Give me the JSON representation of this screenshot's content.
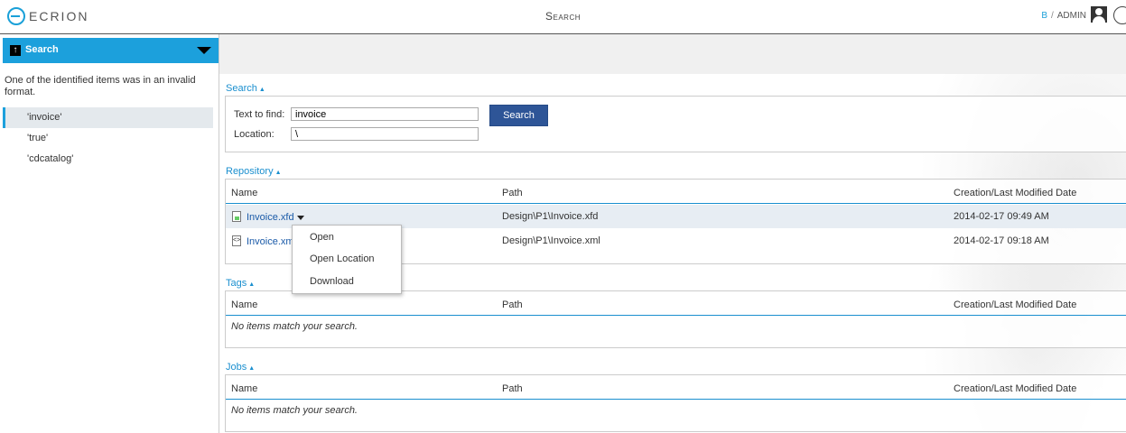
{
  "header": {
    "logo_text": "ECRION",
    "page_title": "Search",
    "user_b": "B",
    "user_sep": "/",
    "user_name": "ADMIN",
    "avatar_icon": "user-avatar-icon",
    "help_icon": "help-icon"
  },
  "sidebar": {
    "title": "Search",
    "icon": "upload-arrow-icon",
    "message": "One of the identified items was in an invalid format.",
    "items": [
      {
        "label": "'invoice'",
        "active": true
      },
      {
        "label": "'true'"
      },
      {
        "label": "'cdcatalog'"
      }
    ]
  },
  "search": {
    "title": "Search",
    "text_label": "Text to find:",
    "text_value": "invoice",
    "location_label": "Location:",
    "location_value": "\\",
    "button": "Search"
  },
  "repository": {
    "title": "Repository",
    "columns": [
      "Name",
      "Path",
      "Creation/Last Modified Date"
    ],
    "rows": [
      {
        "name": "Invoice.xfd",
        "path": "Design\\P1\\Invoice.xfd",
        "date": "2014-02-17 09:49 AM",
        "icon": "xfd-file-icon"
      },
      {
        "name": "Invoice.xml",
        "path": "Design\\P1\\Invoice.xml",
        "date": "2014-02-17 09:18 AM",
        "icon": "xml-file-icon"
      }
    ]
  },
  "context_menu": {
    "items": [
      "Open",
      "Open Location",
      "Download"
    ]
  },
  "tags": {
    "title": "Tags",
    "columns": [
      "Name",
      "Path",
      "Creation/Last Modified Date"
    ],
    "empty": "No items match your search."
  },
  "jobs": {
    "title": "Jobs",
    "columns": [
      "Name",
      "Path",
      "Creation/Last Modified Date"
    ],
    "empty": "No items match your search."
  },
  "colors": {
    "accent": "#1ca0dc",
    "button": "#2e5597",
    "link": "#1a5aa8"
  }
}
